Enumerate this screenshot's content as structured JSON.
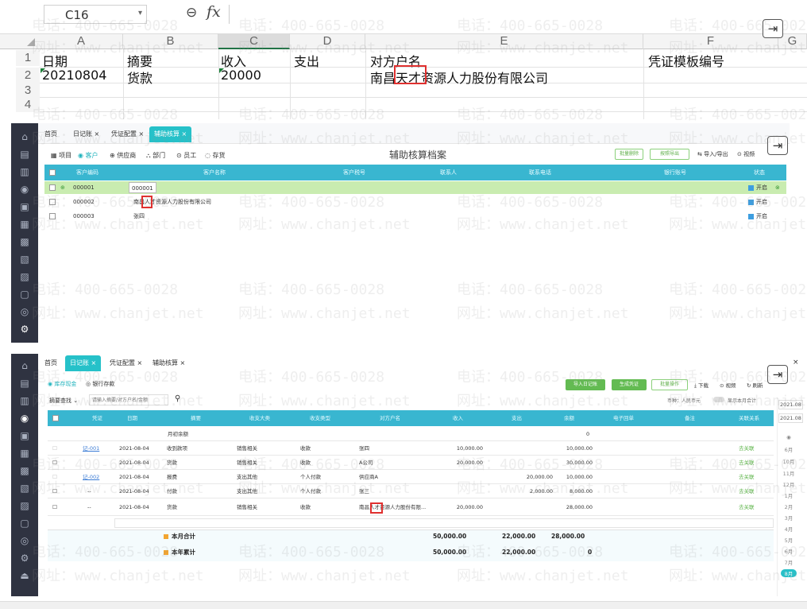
{
  "sheet": {
    "namebox": "C16",
    "fx": "fx",
    "columns": [
      "A",
      "B",
      "C",
      "D",
      "E",
      "F",
      "G"
    ],
    "rows": [
      "1",
      "2",
      "3",
      "4"
    ],
    "headers": [
      "日期",
      "摘要",
      "收入",
      "支出",
      "对方户名",
      "凭证模板编号"
    ],
    "row2": [
      "20210804",
      "货款",
      "20000",
      "",
      "南昌天才资源人力股份有限公司",
      ""
    ]
  },
  "exit_icon": "exit-icon",
  "aux": {
    "tabs": [
      "首页",
      "日记账 ×",
      "凭证配置 ×",
      "辅助核算 ×"
    ],
    "categories": [
      "项目",
      "客户",
      "供应商",
      "部门",
      "员工",
      "存货"
    ],
    "title": "辅助核算档案",
    "buttons": [
      "批量删除",
      "按照导出",
      "导入/导出",
      "视频"
    ],
    "columns": [
      "客户编码",
      "客户名称",
      "客户税号",
      "联系人",
      "联系电话",
      "银行账号",
      "状态"
    ],
    "rows": [
      {
        "code": "000001",
        "name": "000001",
        "status": "开启"
      },
      {
        "code": "000002",
        "name": "南昌人才资源人力股份有限公司",
        "status": "开启"
      },
      {
        "code": "000003",
        "name": "张四",
        "status": "开启"
      }
    ]
  },
  "journal": {
    "tabs": [
      "首页",
      "日记账 ×",
      "凭证配置 ×",
      "辅助核算 ×"
    ],
    "account_tabs": [
      "库存现金",
      "银行存款"
    ],
    "filter_label": "摘要查找",
    "search_placeholder": "请输入摘要/对方户名/金额",
    "buttons": [
      "导入日记账",
      "生成凭证",
      "批量操作",
      "下载",
      "视频",
      "刷新"
    ],
    "currency_label": "币种：人民币元",
    "show_label": "显示本月合计",
    "columns": [
      "凭证",
      "日期",
      "摘要",
      "收支大类",
      "收支类型",
      "对方户名",
      "收入",
      "支出",
      "余额",
      "电子回单",
      "备注",
      "关联关系"
    ],
    "opening": {
      "label": "月初余额",
      "balance": "0"
    },
    "rows": [
      {
        "voucher": "记-001",
        "date": "2021-08-04",
        "summary": "收到款项",
        "major": "销售相关",
        "type": "收款",
        "party": "张四",
        "income": "10,000.00",
        "expense": "",
        "balance": "10,000.00",
        "link": "去关联"
      },
      {
        "voucher": "",
        "date": "2021-08-04",
        "summary": "货款",
        "major": "销售相关",
        "type": "收款",
        "party": "A公司",
        "income": "20,000.00",
        "expense": "",
        "balance": "30,000.00",
        "link": "去关联"
      },
      {
        "voucher": "记-002",
        "date": "2021-08-04",
        "summary": "报费",
        "major": "支出其他",
        "type": "个人付款",
        "party": "供应商A",
        "income": "",
        "expense": "20,000.00",
        "balance": "10,000.00",
        "link": "去关联"
      },
      {
        "voucher": "--",
        "date": "2021-08-04",
        "summary": "付款",
        "major": "支出其他",
        "type": "个人付款",
        "party": "张三",
        "income": "",
        "expense": "2,000.00",
        "balance": "8,000.00",
        "link": "去关联"
      },
      {
        "voucher": "--",
        "date": "2021-08-04",
        "summary": "货款",
        "major": "销售相关",
        "type": "收款",
        "party": "南昌人才资源人力股份有限...",
        "income": "20,000.00",
        "expense": "",
        "balance": "28,000.00",
        "link": "去关联"
      }
    ],
    "month_total": {
      "label": "本月合计",
      "income": "50,000.00",
      "expense": "22,000.00",
      "balance": "28,000.00"
    },
    "year_total": {
      "label": "本年累计",
      "income": "50,000.00",
      "expense": "22,000.00",
      "balance": "0"
    },
    "period_labels": [
      "2021.08",
      "2021.08"
    ],
    "months": [
      "6月",
      "10月",
      "11月",
      "12月",
      "1月",
      "2月",
      "3月",
      "4月",
      "5月",
      "6月",
      "7月",
      "8月"
    ]
  },
  "watermark": {
    "phone": "电话：400-665-0028",
    "site": "网址：www.chanjet.net"
  }
}
